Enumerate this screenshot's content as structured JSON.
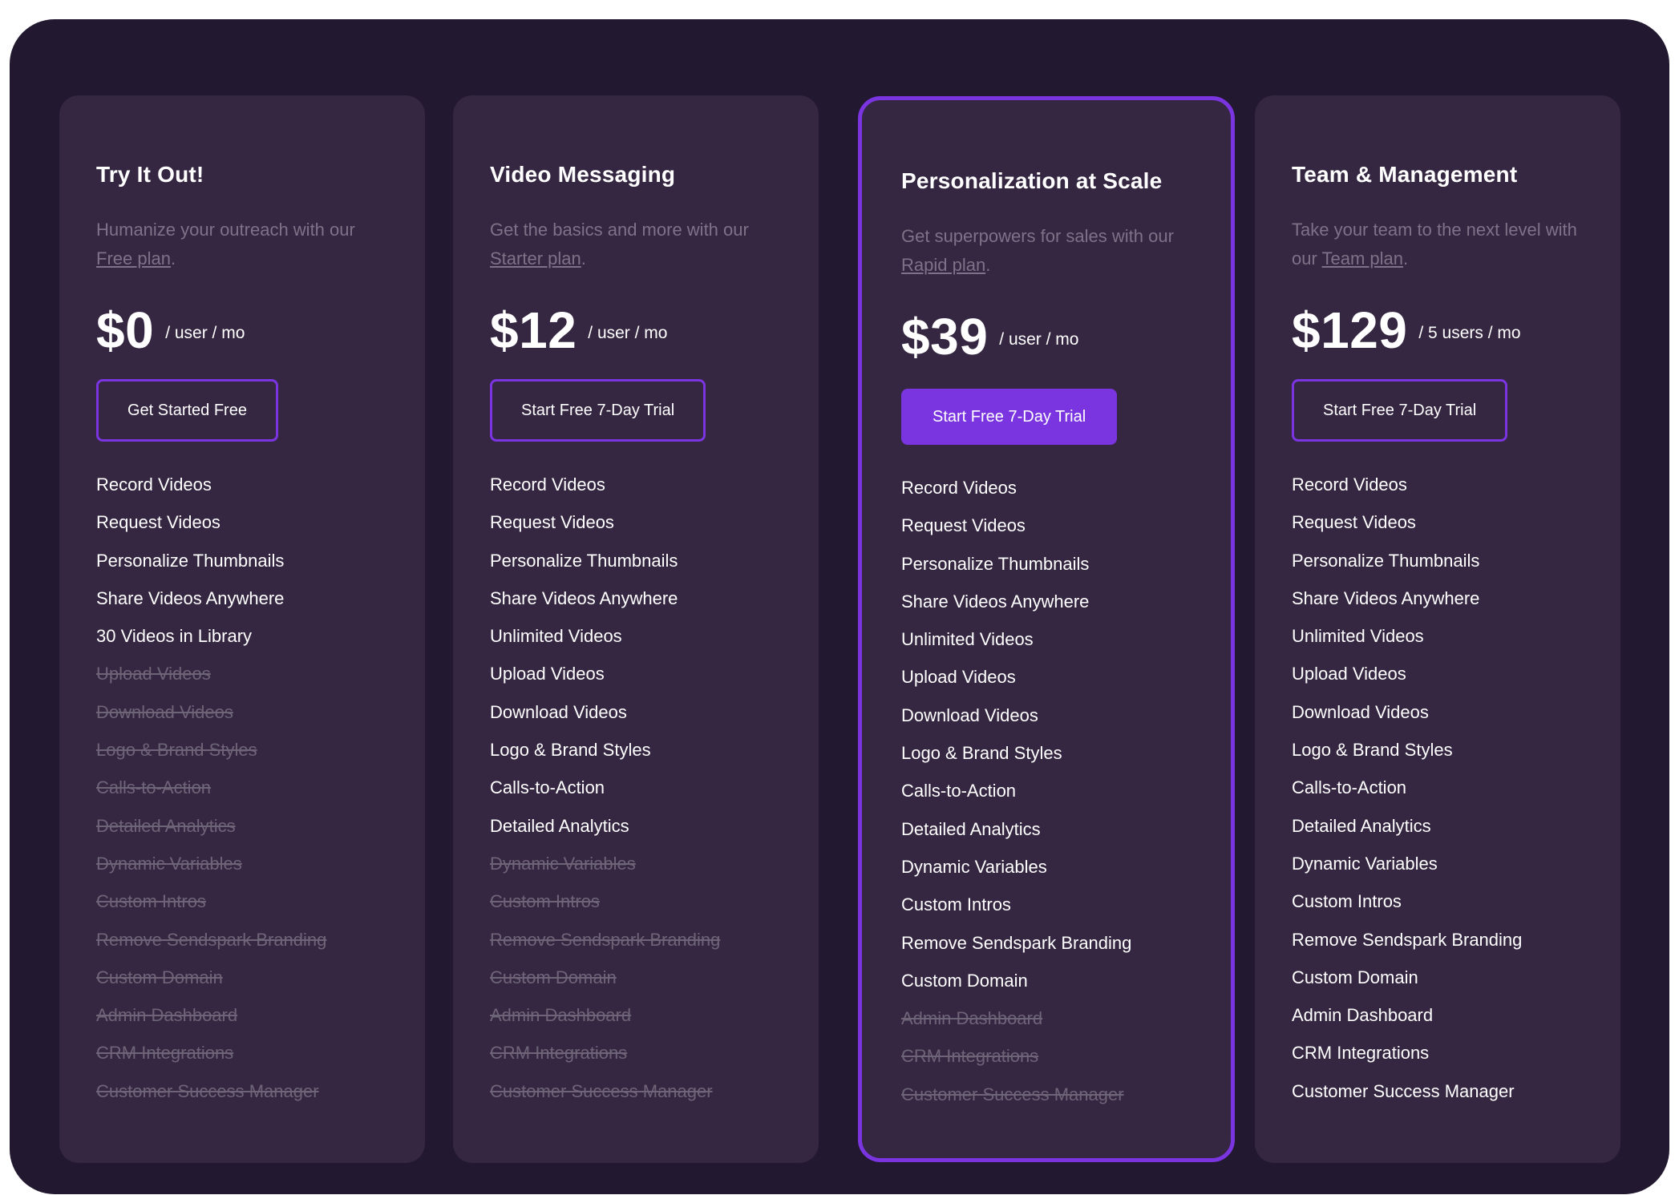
{
  "colors": {
    "panel_bg": "#22182f",
    "card_bg": "#352741",
    "accent": "#7b35e0",
    "muted_text": "#7d7287",
    "disabled_text": "#6e6478"
  },
  "plans": [
    {
      "title": "Try It Out!",
      "desc_text": "Humanize your outreach with our ",
      "desc_link": "Free plan",
      "desc_end": ".",
      "price": "$0",
      "unit": "/ user / mo",
      "button": "Get Started Free",
      "features": [
        {
          "label": "Record Videos",
          "included": true
        },
        {
          "label": "Request Videos",
          "included": true
        },
        {
          "label": "Personalize Thumbnails",
          "included": true
        },
        {
          "label": "Share Videos Anywhere",
          "included": true
        },
        {
          "label": "30 Videos in Library",
          "included": true
        },
        {
          "label": "Upload Videos",
          "included": false
        },
        {
          "label": "Download Videos",
          "included": false
        },
        {
          "label": "Logo & Brand Styles",
          "included": false
        },
        {
          "label": "Calls-to-Action",
          "included": false
        },
        {
          "label": "Detailed Analytics",
          "included": false
        },
        {
          "label": "Dynamic Variables",
          "included": false
        },
        {
          "label": "Custom Intros",
          "included": false
        },
        {
          "label": "Remove Sendspark Branding",
          "included": false
        },
        {
          "label": "Custom Domain",
          "included": false
        },
        {
          "label": "Admin Dashboard",
          "included": false
        },
        {
          "label": "CRM Integrations",
          "included": false
        },
        {
          "label": "Customer Success Manager",
          "included": false
        }
      ]
    },
    {
      "title": "Video Messaging",
      "desc_text": "Get the basics and more with our ",
      "desc_link": "Starter plan",
      "desc_end": ".",
      "price": "$12",
      "unit": "/ user / mo",
      "button": "Start Free 7-Day Trial",
      "features": [
        {
          "label": "Record Videos",
          "included": true
        },
        {
          "label": "Request Videos",
          "included": true
        },
        {
          "label": "Personalize Thumbnails",
          "included": true
        },
        {
          "label": "Share Videos Anywhere",
          "included": true
        },
        {
          "label": "Unlimited Videos",
          "included": true
        },
        {
          "label": "Upload Videos",
          "included": true
        },
        {
          "label": "Download Videos",
          "included": true
        },
        {
          "label": "Logo & Brand Styles",
          "included": true
        },
        {
          "label": "Calls-to-Action",
          "included": true
        },
        {
          "label": "Detailed Analytics",
          "included": true
        },
        {
          "label": "Dynamic Variables",
          "included": false
        },
        {
          "label": "Custom Intros",
          "included": false
        },
        {
          "label": "Remove Sendspark Branding",
          "included": false
        },
        {
          "label": "Custom Domain",
          "included": false
        },
        {
          "label": "Admin Dashboard",
          "included": false
        },
        {
          "label": "CRM Integrations",
          "included": false
        },
        {
          "label": "Customer Success Manager",
          "included": false
        }
      ]
    },
    {
      "title": "Personalization at Scale",
      "desc_text": "Get superpowers for sales with our ",
      "desc_link": "Rapid plan",
      "desc_end": ".",
      "price": "$39",
      "unit": "/ user / mo",
      "button": "Start Free 7-Day Trial",
      "featured": true,
      "features": [
        {
          "label": "Record Videos",
          "included": true
        },
        {
          "label": "Request Videos",
          "included": true
        },
        {
          "label": "Personalize Thumbnails",
          "included": true
        },
        {
          "label": "Share Videos Anywhere",
          "included": true
        },
        {
          "label": "Unlimited Videos",
          "included": true
        },
        {
          "label": "Upload Videos",
          "included": true
        },
        {
          "label": "Download Videos",
          "included": true
        },
        {
          "label": "Logo & Brand Styles",
          "included": true
        },
        {
          "label": "Calls-to-Action",
          "included": true
        },
        {
          "label": "Detailed Analytics",
          "included": true
        },
        {
          "label": "Dynamic Variables",
          "included": true
        },
        {
          "label": "Custom Intros",
          "included": true
        },
        {
          "label": "Remove Sendspark Branding",
          "included": true
        },
        {
          "label": "Custom Domain",
          "included": true
        },
        {
          "label": "Admin Dashboard",
          "included": false
        },
        {
          "label": "CRM Integrations",
          "included": false
        },
        {
          "label": "Customer Success Manager",
          "included": false
        }
      ]
    },
    {
      "title": "Team & Management",
      "desc_text": "Take your team to the next level with our ",
      "desc_link": "Team plan",
      "desc_end": ".",
      "price": "$129",
      "unit": "/ 5 users / mo",
      "button": "Start Free 7-Day Trial",
      "features": [
        {
          "label": "Record Videos",
          "included": true
        },
        {
          "label": "Request Videos",
          "included": true
        },
        {
          "label": "Personalize Thumbnails",
          "included": true
        },
        {
          "label": "Share Videos Anywhere",
          "included": true
        },
        {
          "label": "Unlimited Videos",
          "included": true
        },
        {
          "label": "Upload Videos",
          "included": true
        },
        {
          "label": "Download Videos",
          "included": true
        },
        {
          "label": "Logo & Brand Styles",
          "included": true
        },
        {
          "label": "Calls-to-Action",
          "included": true
        },
        {
          "label": "Detailed Analytics",
          "included": true
        },
        {
          "label": "Dynamic Variables",
          "included": true
        },
        {
          "label": "Custom Intros",
          "included": true
        },
        {
          "label": "Remove Sendspark Branding",
          "included": true
        },
        {
          "label": "Custom Domain",
          "included": true
        },
        {
          "label": "Admin Dashboard",
          "included": true
        },
        {
          "label": "CRM Integrations",
          "included": true
        },
        {
          "label": "Customer Success Manager",
          "included": true
        }
      ]
    }
  ]
}
